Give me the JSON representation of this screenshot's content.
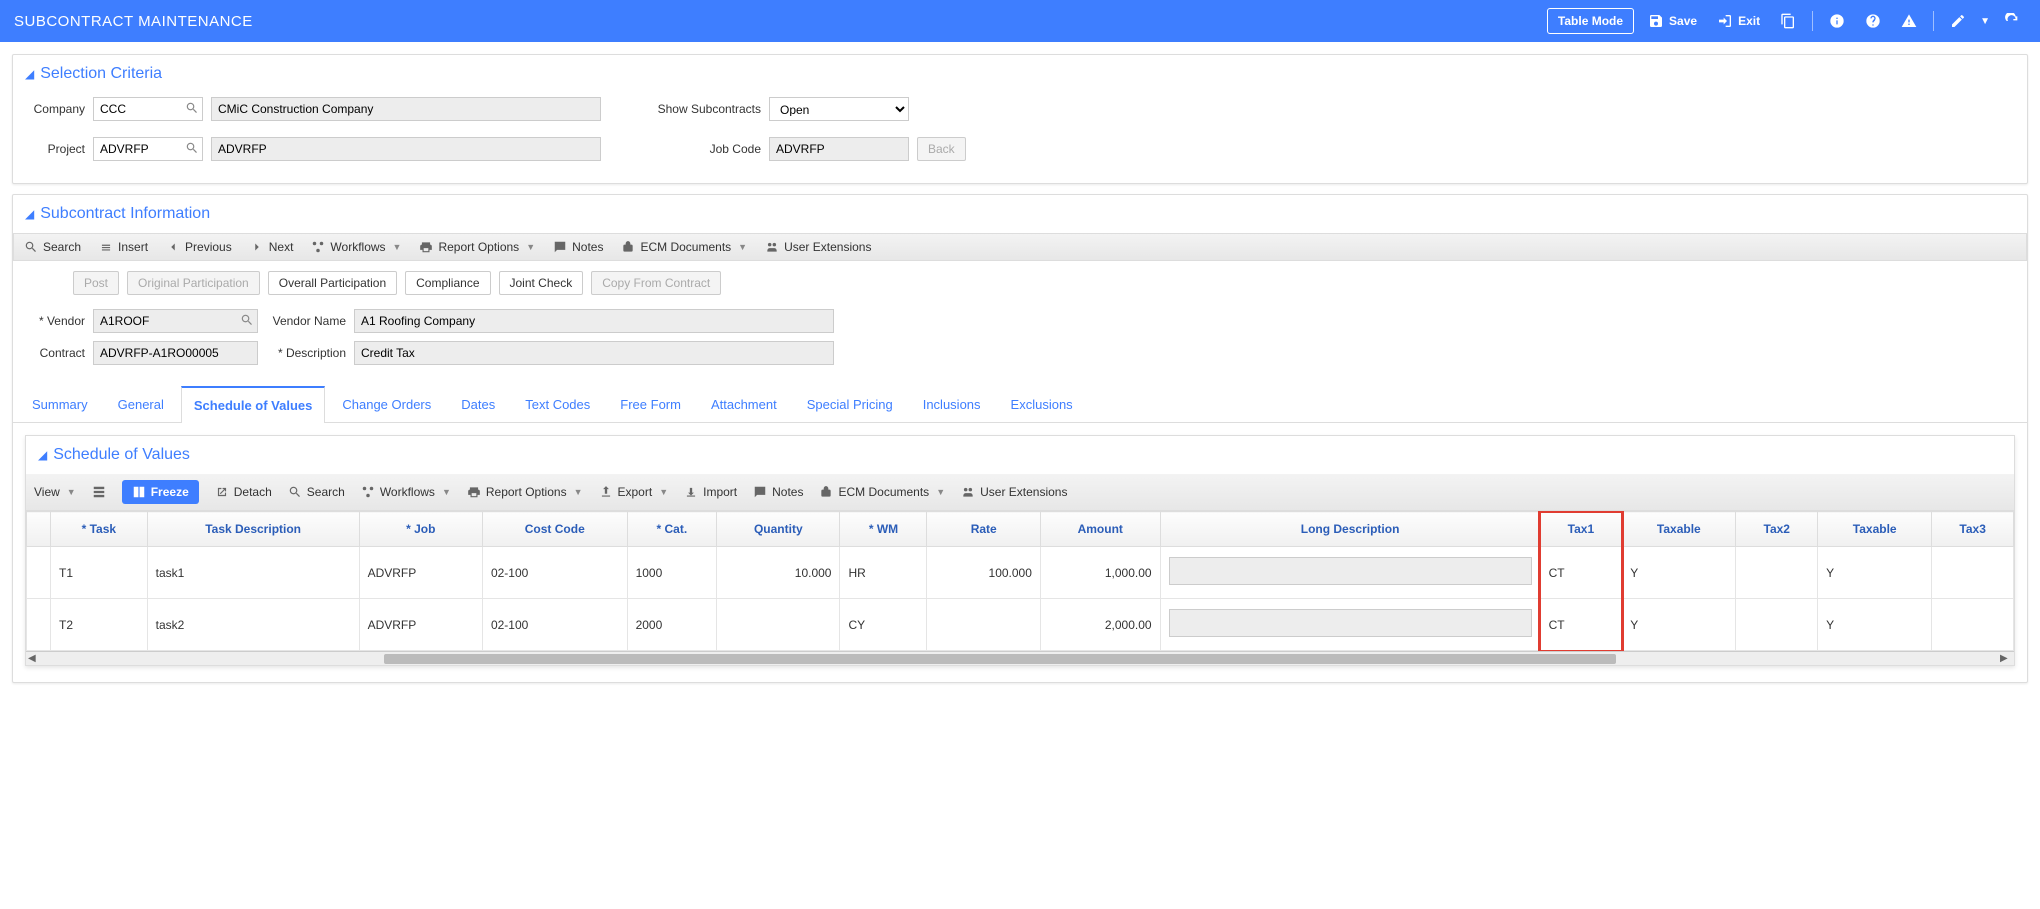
{
  "header": {
    "title": "SUBCONTRACT MAINTENANCE",
    "table_mode": "Table Mode",
    "save": "Save",
    "exit": "Exit"
  },
  "selection": {
    "title": "Selection Criteria",
    "company_label": "Company",
    "company_value": "CCC",
    "company_desc": "CMiC Construction Company",
    "project_label": "Project",
    "project_value": "ADVRFP",
    "project_desc": "ADVRFP",
    "show_sub_label": "Show Subcontracts",
    "show_sub_value": "Open",
    "job_code_label": "Job Code",
    "job_code_value": "ADVRFP",
    "back_label": "Back"
  },
  "subcontract": {
    "title": "Subcontract Information",
    "toolbar": {
      "search": "Search",
      "insert": "Insert",
      "previous": "Previous",
      "next": "Next",
      "workflows": "Workflows",
      "report_options": "Report Options",
      "notes": "Notes",
      "ecm_documents": "ECM Documents",
      "user_extensions": "User Extensions"
    },
    "actions": {
      "post": "Post",
      "original_participation": "Original Participation",
      "overall_participation": "Overall Participation",
      "compliance": "Compliance",
      "joint_check": "Joint Check",
      "copy_from_contract": "Copy From Contract"
    },
    "form": {
      "vendor_label": "Vendor",
      "vendor_value": "A1ROOF",
      "vendor_name_label": "Vendor Name",
      "vendor_name_value": "A1 Roofing Company",
      "contract_label": "Contract",
      "contract_value": "ADVRFP-A1RO00005",
      "description_label": "Description",
      "description_value": "Credit Tax"
    },
    "tabs": [
      "Summary",
      "General",
      "Schedule of Values",
      "Change Orders",
      "Dates",
      "Text Codes",
      "Free Form",
      "Attachment",
      "Special Pricing",
      "Inclusions",
      "Exclusions"
    ],
    "active_tab": "Schedule of Values"
  },
  "sov": {
    "title": "Schedule of Values",
    "toolbar": {
      "view": "View",
      "freeze": "Freeze",
      "detach": "Detach",
      "search": "Search",
      "workflows": "Workflows",
      "report_options": "Report Options",
      "export": "Export",
      "import": "Import",
      "notes": "Notes",
      "ecm_documents": "ECM Documents",
      "user_extensions": "User Extensions"
    },
    "columns": [
      "* Task",
      "Task Description",
      "* Job",
      "Cost Code",
      "* Cat.",
      "Quantity",
      "* WM",
      "Rate",
      "Amount",
      "Long Description",
      "Tax1",
      "Taxable",
      "Tax2",
      "Taxable",
      "Tax3"
    ],
    "rows": [
      {
        "task": "T1",
        "desc": "task1",
        "job": "ADVRFP",
        "cost": "02-100",
        "cat": "1000",
        "qty": "10.000",
        "wm": "HR",
        "rate": "100.000",
        "amount": "1,000.00",
        "long": "",
        "tax1": "CT",
        "taxable1": "Y",
        "tax2": "",
        "taxable2": "Y",
        "tax3": ""
      },
      {
        "task": "T2",
        "desc": "task2",
        "job": "ADVRFP",
        "cost": "02-100",
        "cat": "2000",
        "qty": "",
        "wm": "CY",
        "rate": "",
        "amount": "2,000.00",
        "long": "",
        "tax1": "CT",
        "taxable1": "Y",
        "tax2": "",
        "taxable2": "Y",
        "tax3": ""
      }
    ]
  }
}
